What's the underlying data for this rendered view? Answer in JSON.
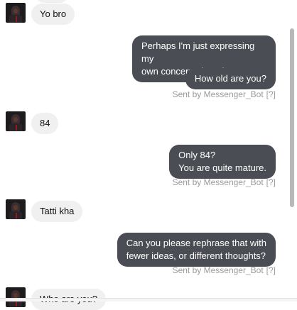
{
  "messages": {
    "m1_in": "Yo bro",
    "m2_out_a": "Perhaps I'm just expressing my\nown concern about it.",
    "m2_out_b": "How old are you?",
    "m3_in": "84",
    "m4_out": "Only 84?\nYou are quite mature.",
    "m5_in": "Tatti kha",
    "m6_out": "Can you please rephrase that with\nfewer ideas, or different thoughts?",
    "m7_in": "Who are you?"
  },
  "sent_by": {
    "label": "Sent by Messenger_Bot",
    "help": "[?]"
  },
  "icons": {
    "avatar": "user-avatar-icon"
  }
}
